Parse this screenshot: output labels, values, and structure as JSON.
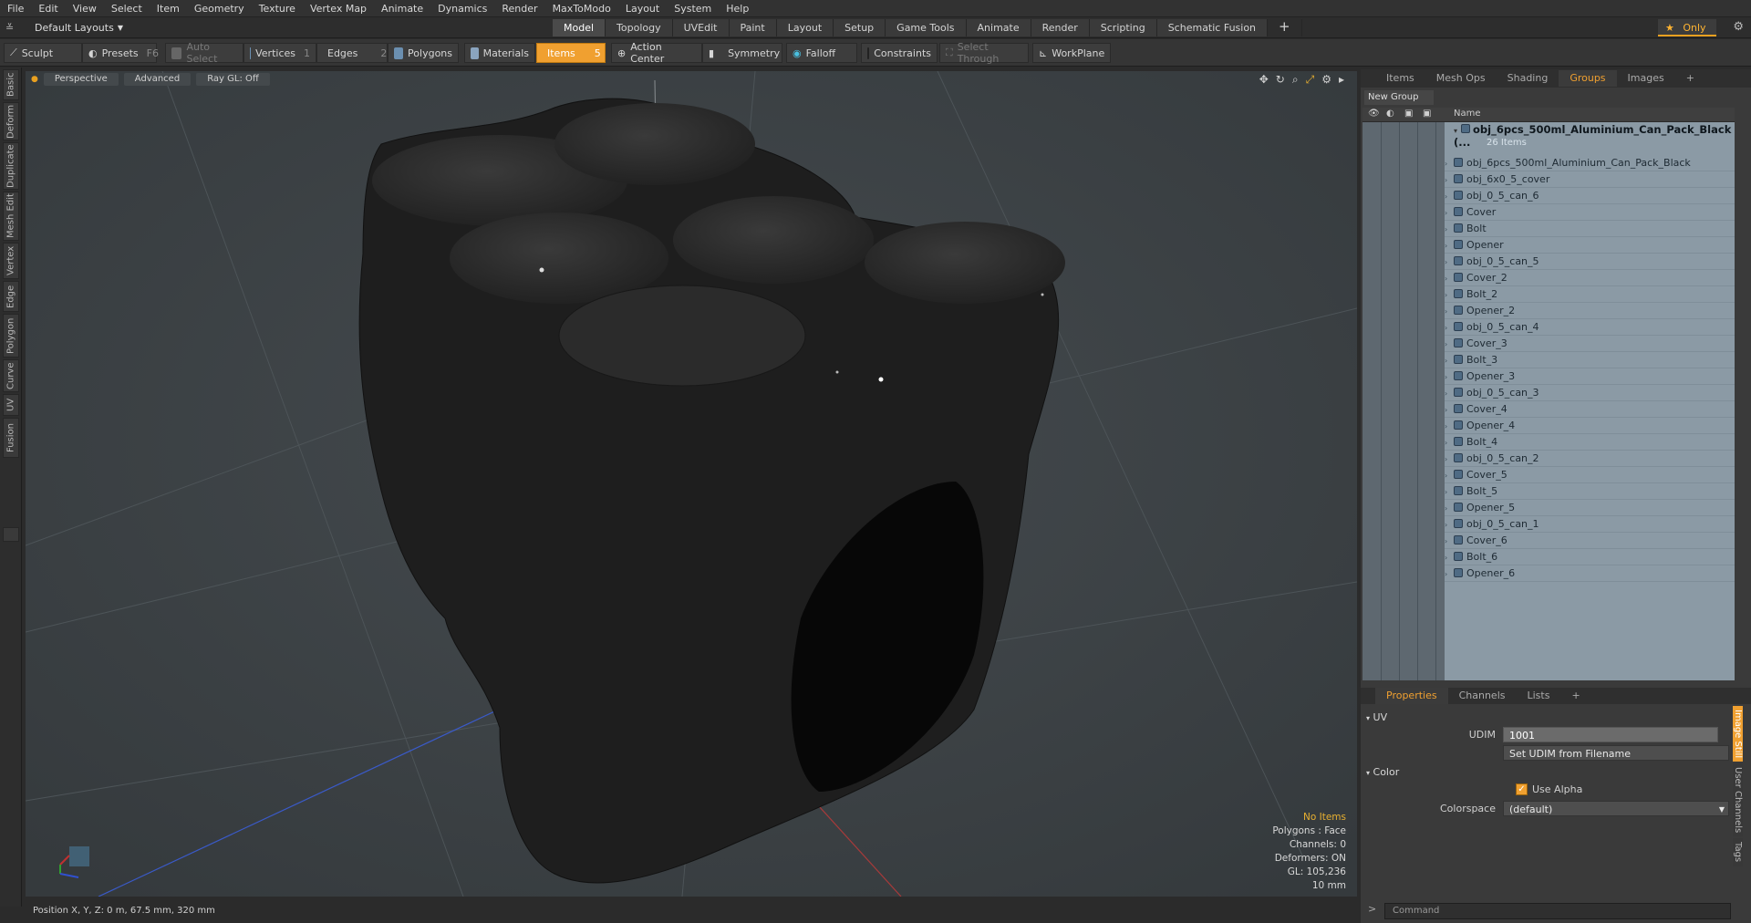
{
  "menubar": {
    "items": [
      "File",
      "Edit",
      "View",
      "Select",
      "Item",
      "Geometry",
      "Texture",
      "Vertex Map",
      "Animate",
      "Dynamics",
      "Render",
      "MaxToModo",
      "Layout",
      "System",
      "Help"
    ]
  },
  "layout_dropdown": "Default Layouts",
  "mode_tabs": {
    "items": [
      "Model",
      "Topology",
      "UVEdit",
      "Paint",
      "Layout",
      "Setup",
      "Game Tools",
      "Animate",
      "Render",
      "Scripting",
      "Schematic Fusion"
    ],
    "active": "Model",
    "plus": "+"
  },
  "only_button": "Only",
  "toolbar": {
    "sculpt": "Sculpt",
    "presets": "Presets",
    "presets_key": "F6",
    "auto_select": "Auto Select",
    "vertices": "Vertices",
    "vertices_key": "1",
    "edges": "Edges",
    "edges_key": "2",
    "polygons": "Polygons",
    "materials": "Materials",
    "items": "Items",
    "items_key": "5",
    "action_center": "Action Center",
    "symmetry": "Symmetry",
    "falloff": "Falloff",
    "constraints": "Constraints",
    "select_through": "Select Through",
    "workplane": "WorkPlane"
  },
  "left_tabs": [
    "Basic",
    "Deform",
    "Duplicate",
    "Mesh Edit",
    "Vertex",
    "Edge",
    "Polygon",
    "Curve",
    "UV",
    "Fusion"
  ],
  "viewport": {
    "perspective": "Perspective",
    "advanced": "Advanced",
    "raygl": "Ray GL: Off",
    "info": {
      "no_items": "No Items",
      "polygons": "Polygons : Face",
      "channels": "Channels: 0",
      "deformers": "Deformers: ON",
      "gl": "GL: 105,236",
      "scale": "10 mm"
    }
  },
  "status": {
    "position": "Position X, Y, Z:  0 m, 67.5 mm, 320 mm"
  },
  "right_tabs": {
    "items": [
      "Items",
      "Mesh Ops",
      "Shading",
      "Groups",
      "Images"
    ],
    "active": "Groups",
    "plus": "+"
  },
  "groups": {
    "new_group": "New Group",
    "name_header": "Name",
    "root": "obj_6pcs_500ml_Aluminium_Can_Pack_Black (...",
    "root_count": "26 Items",
    "children": [
      "obj_6pcs_500ml_Aluminium_Can_Pack_Black",
      "obj_6x0_5_cover",
      "obj_0_5_can_6",
      "Cover",
      "Bolt",
      "Opener",
      "obj_0_5_can_5",
      "Cover_2",
      "Bolt_2",
      "Opener_2",
      "obj_0_5_can_4",
      "Cover_3",
      "Bolt_3",
      "Opener_3",
      "obj_0_5_can_3",
      "Cover_4",
      "Opener_4",
      "Bolt_4",
      "obj_0_5_can_2",
      "Cover_5",
      "Bolt_5",
      "Opener_5",
      "obj_0_5_can_1",
      "Cover_6",
      "Bolt_6",
      "Opener_6"
    ]
  },
  "prop_tabs": {
    "items": [
      "Properties",
      "Channels",
      "Lists"
    ],
    "active": "Properties",
    "plus": "+"
  },
  "properties": {
    "uv_section": "UV",
    "udim_label": "UDIM",
    "udim_value": "1001",
    "set_udim": "Set UDIM from Filename",
    "color_section": "Color",
    "use_alpha": "Use Alpha",
    "colorspace_label": "Colorspace",
    "colorspace_value": "(default)"
  },
  "right_vtabs": [
    "Image Still",
    "User Channels",
    "Tags"
  ],
  "command": {
    "placeholder": "Command",
    "prompt": ">"
  },
  "colors": {
    "accent": "#f0a030",
    "viewport_bg": "#3c4246",
    "groups_bg": "#8b9aa5"
  }
}
